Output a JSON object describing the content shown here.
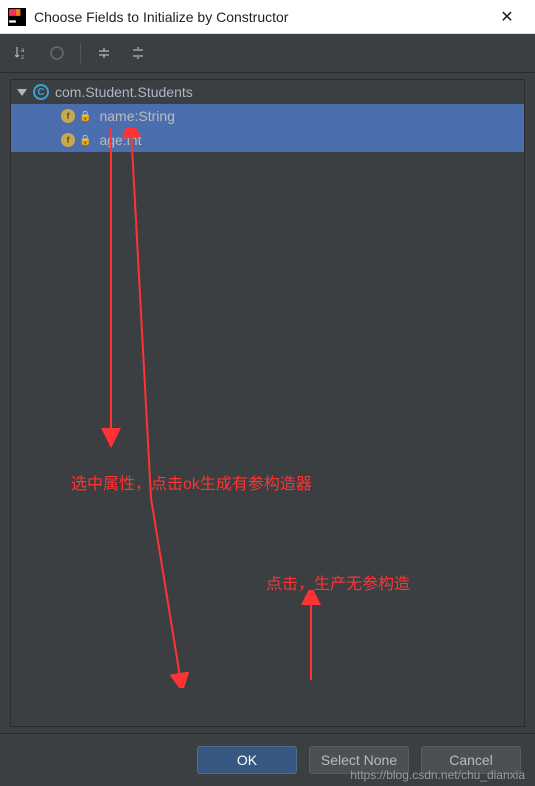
{
  "titlebar": {
    "title": "Choose Fields to Initialize by Constructor"
  },
  "tree": {
    "class_name": "com.Student.Students",
    "fields": [
      {
        "name": "name:String"
      },
      {
        "name": "age:int"
      }
    ]
  },
  "annotations": {
    "select_fields": "选中属性，点击ok生成有参构造器",
    "select_none": "点击，生产无参构造"
  },
  "buttons": {
    "ok": "OK",
    "select_none": "Select None",
    "cancel": "Cancel"
  },
  "watermark": "https://blog.csdn.net/chu_dianxia"
}
